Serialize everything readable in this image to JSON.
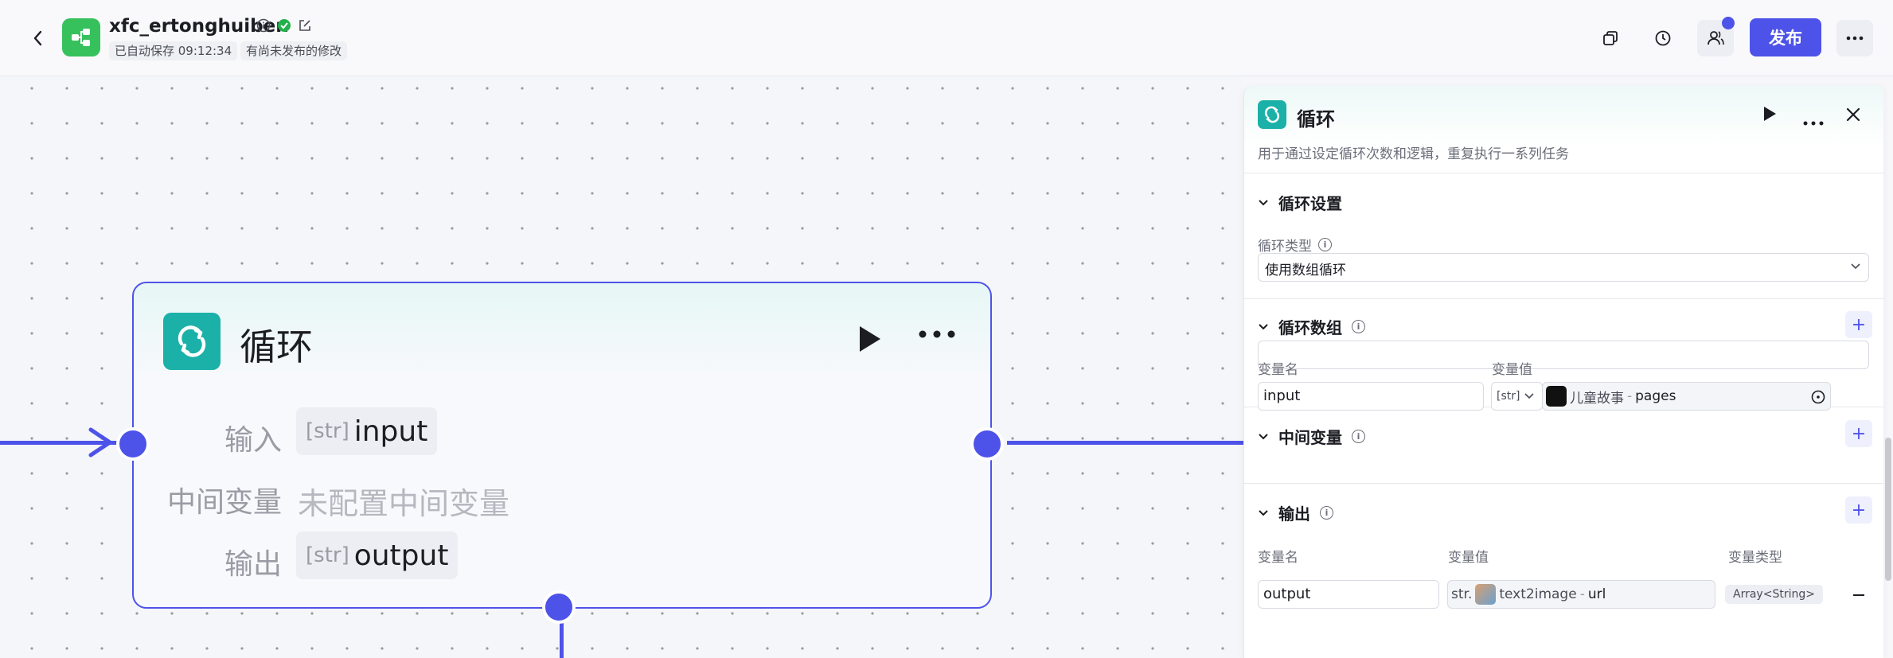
{
  "header": {
    "app_name": "xfc_ertonghuiben",
    "saved_tag": "已自动保存 09:12:34",
    "unpublished_tag": "有尚未发布的修改",
    "publish_label": "发布"
  },
  "node": {
    "title": "循环",
    "rows": {
      "input_label": "输入",
      "input_type": "[str]",
      "input_name": "input",
      "mid_label": "中间变量",
      "mid_value": "未配置中间变量",
      "output_label": "输出",
      "output_type": "[str]",
      "output_name": "output"
    }
  },
  "panel": {
    "title": "循环",
    "description": "用于通过设定循环次数和逻辑，重复执行一系列任务",
    "loop_settings": {
      "title": "循环设置",
      "type_label": "循环类型",
      "type_value": "使用数组循环"
    },
    "loop_array": {
      "title": "循环数组",
      "col_name": "变量名",
      "col_value": "变量值",
      "row": {
        "name": "input",
        "type": "[str]",
        "ref_node": "儿童故事",
        "ref_sep": "-",
        "ref_field": "pages"
      }
    },
    "mid_vars": {
      "title": "中间变量"
    },
    "output": {
      "title": "输出",
      "col_name": "变量名",
      "col_value": "变量值",
      "col_type": "变量类型",
      "row": {
        "name": "output",
        "type": "str.",
        "ref_node": "text2image",
        "ref_sep": "-",
        "ref_field": "url",
        "var_type": "Array<String>"
      }
    }
  },
  "colors": {
    "accent": "#4d53e8",
    "loop_icon": "#1bb0a8",
    "app_icon": "#37c15d",
    "success": "#22b14c"
  }
}
